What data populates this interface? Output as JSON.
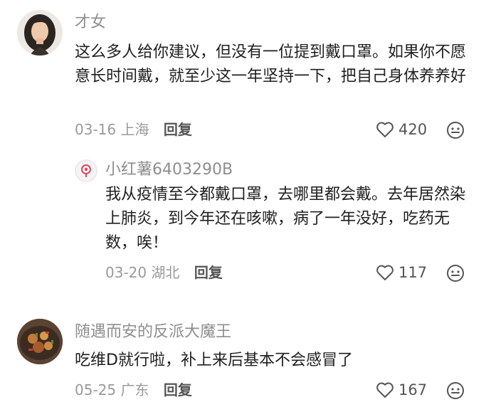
{
  "comments": [
    {
      "author": "才女",
      "text": "这么多人给你建议，但没有一位提到戴口罩。如果你不愿意长时间戴，就至少这一年坚持一下，把自己身体养养好",
      "date": "03-16",
      "location": "上海",
      "reply_label": "回复",
      "likes": "420",
      "avatar_icon": "woman-portrait-icon"
    },
    {
      "author": "小红薯6403290B",
      "text": "我从疫情至今都戴口罩，去哪里都会戴。去年居然染上肺炎，到今年还在咳嗽，病了一年没好，吃药无数，唉！",
      "date": "03-20",
      "location": "湖北",
      "reply_label": "回复",
      "likes": "117",
      "avatar_icon": "default-avatar-icon"
    },
    {
      "author": "随遇而安的反派大魔王",
      "text": "吃维D就行啦，补上来后基本不会感冒了",
      "date": "05-25",
      "location": "广东",
      "reply_label": "回复",
      "likes": "167",
      "avatar_icon": "food-dish-avatar-icon"
    }
  ],
  "colors": {
    "name": "#8e8e8e",
    "text": "#1f1f1f",
    "meta": "#9a9a9a"
  }
}
